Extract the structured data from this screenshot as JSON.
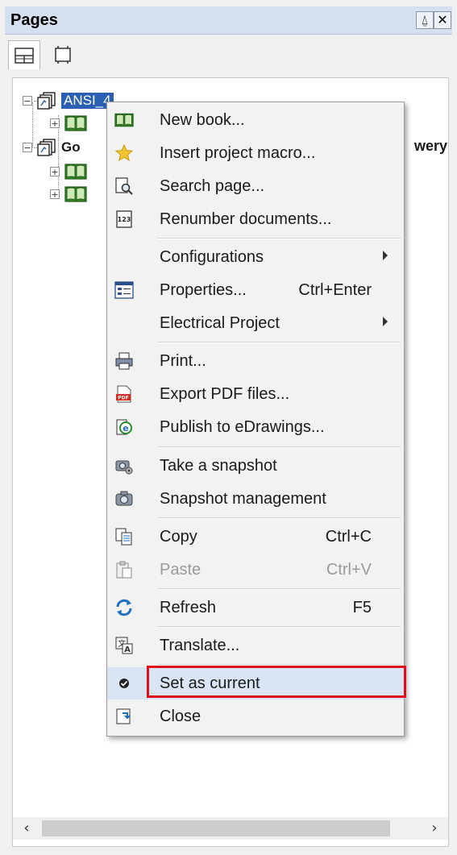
{
  "panel": {
    "title": "Pages",
    "pin_glyph": "⍙",
    "close_glyph": "✕"
  },
  "tabs": [
    {
      "icon": "page-layout-icon",
      "active": true
    },
    {
      "icon": "frame-icon",
      "active": false
    }
  ],
  "tree": {
    "project1_label": "ANSI_4",
    "project2_label_partial": "Go",
    "project2_label_tail": "wery",
    "expander_minus": "−",
    "expander_plus": "+"
  },
  "menu": {
    "items": [
      {
        "label": "New book...",
        "shortcut": "",
        "icon": "book-icon",
        "disabled": false,
        "submenu": false
      },
      {
        "label": "Insert project macro...",
        "shortcut": "",
        "icon": "star-icon",
        "disabled": false,
        "submenu": false
      },
      {
        "label": "Search page...",
        "shortcut": "",
        "icon": "search-page-icon",
        "disabled": false,
        "submenu": false
      },
      {
        "label": "Renumber documents...",
        "shortcut": "",
        "icon": "renumber-icon",
        "disabled": false,
        "submenu": false
      },
      {
        "label": "Configurations",
        "shortcut": "",
        "icon": "",
        "disabled": false,
        "submenu": true
      },
      {
        "label": "Properties...",
        "shortcut": "Ctrl+Enter",
        "icon": "properties-icon",
        "disabled": false,
        "submenu": false
      },
      {
        "label": "Electrical Project",
        "shortcut": "",
        "icon": "",
        "disabled": false,
        "submenu": true
      },
      {
        "label": "Print...",
        "shortcut": "",
        "icon": "printer-icon",
        "disabled": false,
        "submenu": false
      },
      {
        "label": "Export PDF files...",
        "shortcut": "",
        "icon": "pdf-icon",
        "disabled": false,
        "submenu": false
      },
      {
        "label": "Publish to eDrawings...",
        "shortcut": "",
        "icon": "edrawings-icon",
        "disabled": false,
        "submenu": false
      },
      {
        "label": "Take a snapshot",
        "shortcut": "",
        "icon": "snapshot-icon",
        "disabled": false,
        "submenu": false
      },
      {
        "label": "Snapshot management",
        "shortcut": "",
        "icon": "camera-icon",
        "disabled": false,
        "submenu": false
      },
      {
        "label": "Copy",
        "shortcut": "Ctrl+C",
        "icon": "copy-icon",
        "disabled": false,
        "submenu": false
      },
      {
        "label": "Paste",
        "shortcut": "Ctrl+V",
        "icon": "paste-icon",
        "disabled": true,
        "submenu": false
      },
      {
        "label": "Refresh",
        "shortcut": "F5",
        "icon": "refresh-icon",
        "disabled": false,
        "submenu": false
      },
      {
        "label": "Translate...",
        "shortcut": "",
        "icon": "translate-icon",
        "disabled": false,
        "submenu": false
      },
      {
        "label": "Set as current",
        "shortcut": "",
        "icon": "check-icon",
        "disabled": false,
        "submenu": false,
        "highlighted": true
      },
      {
        "label": "Close",
        "shortcut": "",
        "icon": "close-project-icon",
        "disabled": false,
        "submenu": false
      }
    ]
  },
  "scrollbar": {
    "left_arrow": "‹",
    "right_arrow": "›"
  },
  "colors": {
    "selection": "#2b5fb3",
    "highlight_border": "#e0101b",
    "menu_hover": "#d9e5f5"
  }
}
